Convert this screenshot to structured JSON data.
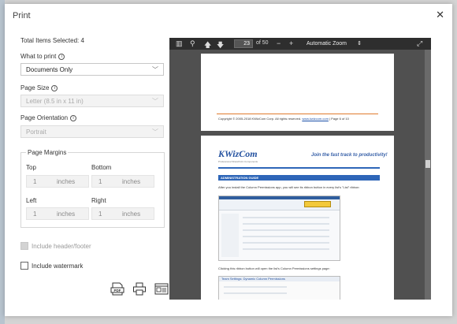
{
  "dialog": {
    "title": "Print",
    "close_glyph": "✕"
  },
  "left": {
    "total_label": "Total Items Selected: 4",
    "what_to_print": {
      "label": "What to print",
      "value": "Documents Only"
    },
    "page_size": {
      "label": "Page Size",
      "value": "Letter (8.5 in x 11 in)"
    },
    "page_orientation": {
      "label": "Page Orientation",
      "value": "Portrait"
    },
    "page_margins": {
      "legend": "Page Margins",
      "top": {
        "label": "Top",
        "value": "1",
        "unit": "inches"
      },
      "bottom": {
        "label": "Bottom",
        "value": "1",
        "unit": "inches"
      },
      "left": {
        "label": "Left",
        "value": "1",
        "unit": "inches"
      },
      "right": {
        "label": "Right",
        "value": "1",
        "unit": "inches"
      }
    },
    "include_header_footer": {
      "label": "Include header/footer",
      "checked": false,
      "disabled": true
    },
    "include_watermark": {
      "label": "Include watermark",
      "checked": false,
      "disabled": false
    }
  },
  "actions": {
    "icons": [
      "pdf-icon",
      "printer-icon",
      "preview-icon"
    ],
    "pdf_text": "PDF"
  },
  "viewer": {
    "page_number": "23",
    "page_total_label": "of 50",
    "zoom": "Automatic Zoom",
    "page1": {
      "copyright": "Copyright © 2005-2018 KWizCom Corp. All rights reserved.",
      "link": "www.kwizcom.com",
      "page_info": "| Page 6 of 10"
    },
    "page2": {
      "logo": "KWizCom",
      "logo_sub": "Professional SharePoint Components",
      "tagline": "Join the fast track to productivity!",
      "section": "ADMINISTRATION GUIDE",
      "para1": "After you install the Column Permissions app, you will see its ribbon button in every list's \"List\" ribbon:",
      "para2": "Clicking this ribbon button will open the list's Column Permissions settings page:",
      "shot2_title": "Team Settings: Dynamic Column Permissions"
    }
  },
  "colors": {
    "accent_blue": "#2e66b8",
    "orange_rule": "#e07a2e",
    "viewer_bg": "#505050",
    "toolbar_bg": "#2e2e2e"
  }
}
